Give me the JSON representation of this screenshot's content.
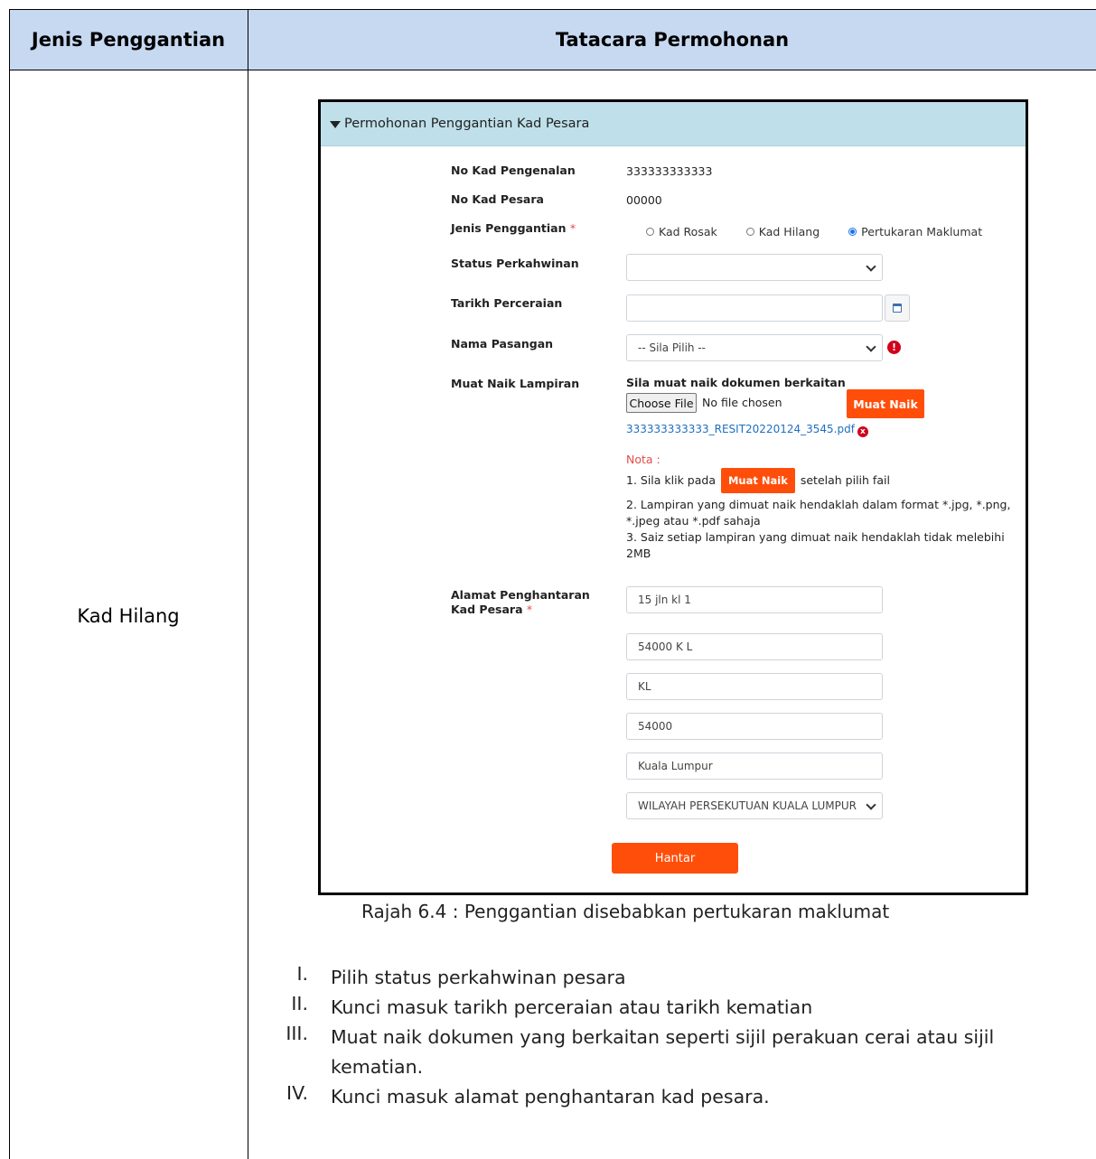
{
  "table": {
    "header_left": "Jenis Penggantian",
    "header_right": "Tatacara Permohonan",
    "row_label": "Kad Hilang",
    "header_bg": "#c6d9f1"
  },
  "form": {
    "panel_title": "Permohonan Penggantian Kad Pesara",
    "panel_icon": "filter-icon",
    "no_kp_label": "No Kad Pengenalan",
    "no_kp_value": "333333333333",
    "no_kad_label": "No Kad Pesara",
    "no_kad_value": "00000",
    "jenis_label": "Jenis Penggantian",
    "required_mark": "*",
    "radios": [
      "Kad Rosak",
      "Kad Hilang",
      "Pertukaran Maklumat"
    ],
    "radio_selected": "Pertukaran Maklumat",
    "status_label": "Status Perkahwinan",
    "status_value": "",
    "tarikh_label": "Tarikh Perceraian",
    "tarikh_value": "",
    "pasangan_label": "Nama Pasangan",
    "pasangan_value": "-- Sila Pilih --",
    "warn_icon_text": "!",
    "lampiran_label": "Muat Naik Lampiran",
    "upload_title": "Sila muat naik dokumen berkaitan",
    "choose_file": "Choose File",
    "no_file": "No file chosen",
    "muat_naik_btn": "Muat Naik",
    "uploaded_file": "333333333333_RESIT20220124_3545.pdf",
    "remove_icon_text": "x",
    "nota_title": "Nota :",
    "nota_1_pre": "1. Sila klik pada",
    "nota_1_btn": "Muat Naik",
    "nota_1_post": "setelah pilih fail",
    "nota_2": "2. Lampiran yang dimuat naik hendaklah dalam format *.jpg, *.png, *.jpeg atau *.pdf sahaja",
    "nota_3": "3. Saiz setiap lampiran yang dimuat naik hendaklah tidak melebihi 2MB",
    "alamat_label": "Alamat Penghantaran Kad Pesara",
    "alamat_1": "15 jln kl 1",
    "alamat_2": "54000 K L",
    "alamat_3": "KL",
    "poskod": "54000",
    "bandar": "Kuala Lumpur",
    "negeri": "WILAYAH PERSEKUTUAN KUALA LUMPUR",
    "hantar_btn": "Hantar",
    "accent": "#ff4e0a",
    "panel_bg": "#bfe0ea"
  },
  "caption": "Rajah 6.4 : Penggantian disebabkan pertukaran maklumat",
  "steps": [
    {
      "num": "I.",
      "text": "Pilih status perkahwinan pesara"
    },
    {
      "num": "II.",
      "text": "Kunci masuk tarikh perceraian atau tarikh kematian"
    },
    {
      "num": "III.",
      "text": "Muat naik dokumen yang berkaitan seperti sijil perakuan cerai atau sijil kematian."
    },
    {
      "num": "IV.",
      "text": "Kunci masuk alamat penghantaran kad pesara."
    }
  ]
}
